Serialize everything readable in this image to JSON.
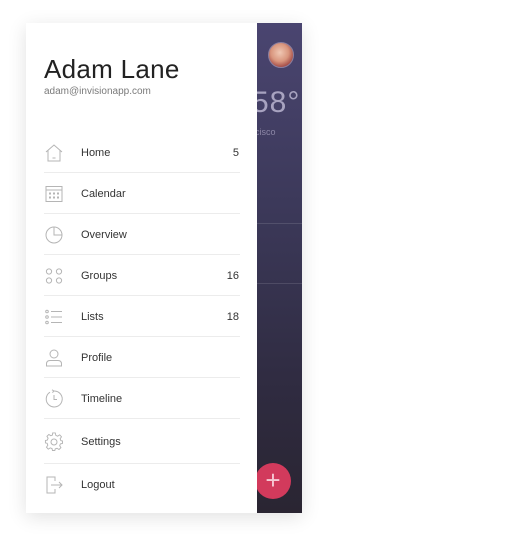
{
  "user": {
    "name": "Adam Lane",
    "email": "adam@invisionapp.com"
  },
  "background_app": {
    "temperature": "58°",
    "city_partial": "ncisco"
  },
  "menu": [
    {
      "label": "Home",
      "count": "5",
      "icon": "home-icon"
    },
    {
      "label": "Calendar",
      "count": "",
      "icon": "calendar-icon"
    },
    {
      "label": "Overview",
      "count": "",
      "icon": "pie-chart-icon"
    },
    {
      "label": "Groups",
      "count": "16",
      "icon": "groups-icon"
    },
    {
      "label": "Lists",
      "count": "18",
      "icon": "list-icon"
    },
    {
      "label": "Profile",
      "count": "",
      "icon": "user-icon"
    },
    {
      "label": "Timeline",
      "count": "",
      "icon": "timeline-icon"
    },
    {
      "label": "Settings",
      "count": "",
      "icon": "gear-icon"
    },
    {
      "label": "Logout",
      "count": "",
      "icon": "logout-icon"
    }
  ],
  "fab": {
    "label": "+"
  },
  "colors": {
    "accent": "#d23a5c",
    "background_gradient_top": "#4a4570",
    "background_gradient_bottom": "#2a2532",
    "icon_stroke": "#b5b5b5"
  }
}
